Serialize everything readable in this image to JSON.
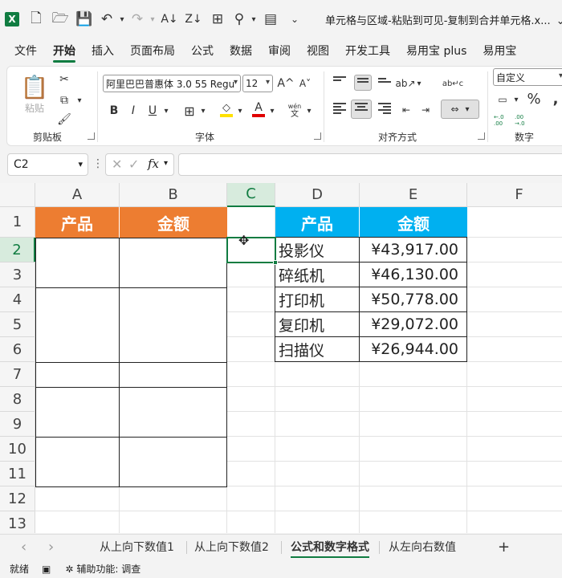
{
  "titlebar": {
    "app_icon": "X",
    "title": "单元格与区域-粘贴到可见-复制到合并单元格.x...",
    "chevron": "⌄"
  },
  "menu": [
    "文件",
    "开始",
    "插入",
    "页面布局",
    "公式",
    "数据",
    "审阅",
    "视图",
    "开发工具",
    "易用宝 plus",
    "易用宝"
  ],
  "ribbon": {
    "clipboard": {
      "paste_label": "粘贴",
      "group_label": "剪贴板"
    },
    "font": {
      "font_name": "阿里巴巴普惠体 3.0 55 Regu",
      "font_size": "12",
      "bold": "B",
      "italic": "I",
      "underline": "U",
      "grow": "A^",
      "shrink": "A˅",
      "phonetic_top": "wén",
      "phonetic_bottom": "文",
      "group_label": "字体",
      "font_color_letter": "A"
    },
    "alignment": {
      "group_label": "对齐方式",
      "wrap_icon": "ab↵c"
    },
    "number": {
      "format": "自定义",
      "percent": "%",
      "group_label": "数字",
      "dec_inc": "←.0 .00",
      "dec_dec": ".00 →.0"
    },
    "colors": {
      "accent": "#107c41",
      "fill_yellow": "#ffe100",
      "font_red": "#e00000"
    }
  },
  "formula": {
    "namebox": "C2",
    "value": "",
    "fx": "fx"
  },
  "grid": {
    "columns": [
      "A",
      "B",
      "C",
      "D",
      "E",
      "F"
    ],
    "rows": [
      "1",
      "2",
      "3",
      "4",
      "5",
      "6",
      "7",
      "8",
      "9",
      "10",
      "11",
      "12",
      "13"
    ],
    "left_table": {
      "header_product": "产品",
      "header_amount": "金额",
      "header_color": "#ed7d31"
    },
    "right_table": {
      "header_product": "产品",
      "header_amount": "金额",
      "header_color": "#00b0f0",
      "rows": [
        {
          "product": "投影仪",
          "amount": "¥43,917.00"
        },
        {
          "product": "碎纸机",
          "amount": "¥46,130.00"
        },
        {
          "product": "打印机",
          "amount": "¥50,778.00"
        },
        {
          "product": "复印机",
          "amount": "¥29,072.00"
        },
        {
          "product": "扫描仪",
          "amount": "¥26,944.00"
        }
      ]
    }
  },
  "sheets": {
    "tabs": [
      "从上向下数值1",
      "从上向下数值2",
      "公式和数字格式",
      "从左向右数值"
    ],
    "active_index": 2,
    "add": "+",
    "nav_prev": "‹",
    "nav_next": "›"
  },
  "status": {
    "ready": "就绪",
    "accessibility": "辅助功能: 调查"
  }
}
